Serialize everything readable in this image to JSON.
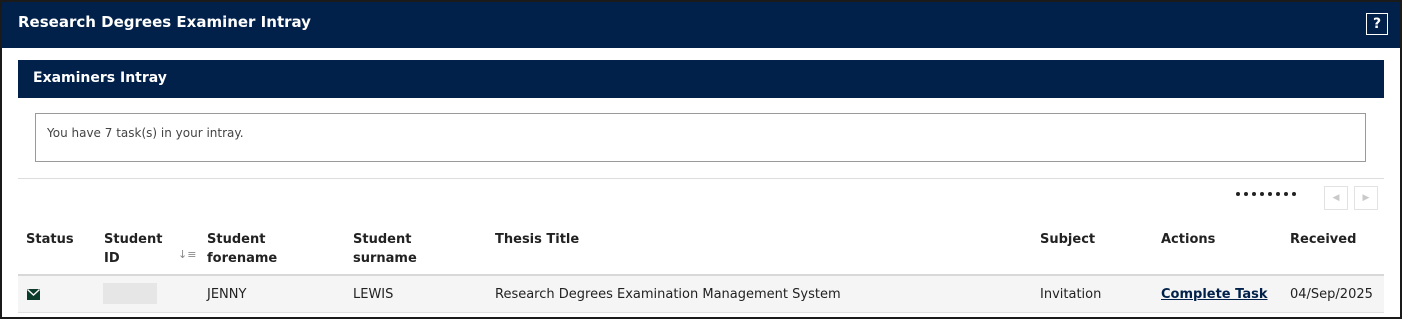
{
  "app": {
    "title": "Research Degrees Examiner Intray",
    "help_label": "?"
  },
  "panel": {
    "title": "Examiners Intray",
    "message": "You have 7 task(s) in your intray."
  },
  "pager": {
    "prev_icon": "chevron-left-icon",
    "next_icon": "chevron-right-icon"
  },
  "table": {
    "columns": [
      {
        "line1": "Status",
        "line2": ""
      },
      {
        "line1": "Student",
        "line2": "ID"
      },
      {
        "line1": "Student",
        "line2": "forename"
      },
      {
        "line1": "Student",
        "line2": "surname"
      },
      {
        "line1": "Thesis Title",
        "line2": ""
      },
      {
        "line1": "Subject",
        "line2": ""
      },
      {
        "line1": "Actions",
        "line2": ""
      },
      {
        "line1": "Received",
        "line2": ""
      }
    ],
    "sort_icon": "sort-descending-icon",
    "rows": [
      {
        "status_icon": "envelope-icon",
        "student_id": "",
        "forename": "JENNY",
        "surname": "LEWIS",
        "thesis_title": "Research Degrees Examination Management System",
        "subject": "Invitation",
        "action": "Complete Task",
        "received": "04/Sep/2025"
      }
    ]
  },
  "colors": {
    "header_navy": "#01214a",
    "row_background": "#f5f5f5",
    "link": "#01214a",
    "envelope_green": "#0b3b2a"
  }
}
